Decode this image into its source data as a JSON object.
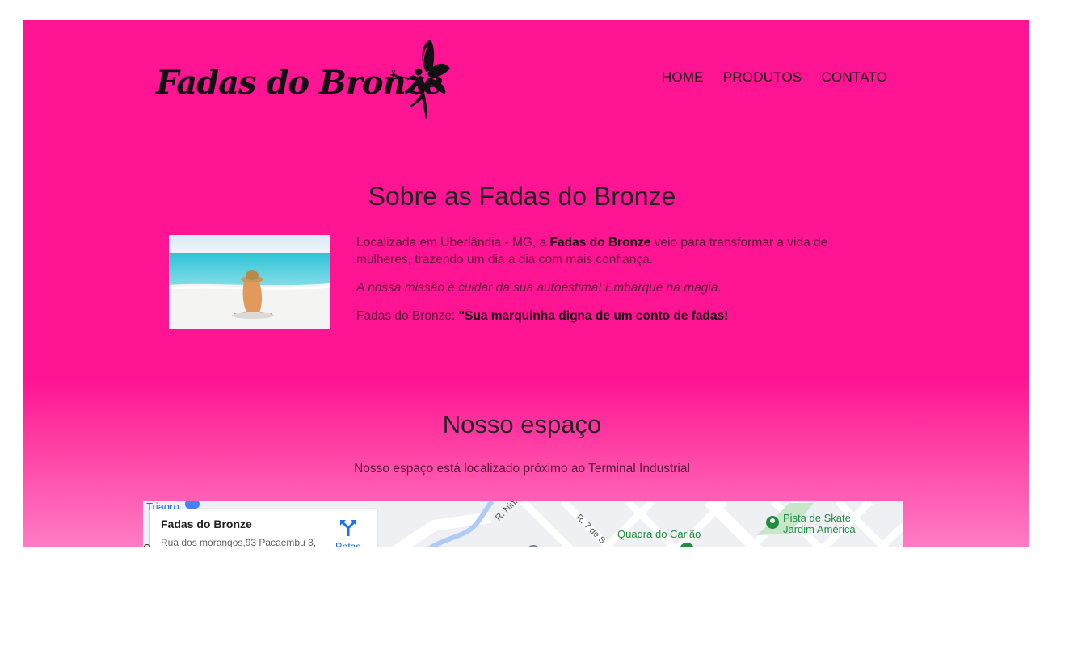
{
  "header": {
    "logo_text": "Fadas do Bronze",
    "nav": [
      "HOME",
      "PRODUTOS",
      "CONTATO"
    ]
  },
  "about": {
    "title": "Sobre as Fadas do Bronze",
    "p1_prefix": "Localizada em Uberlândia - MG, a ",
    "p1_bold": "Fadas do Bronze",
    "p1_suffix": " veio para transformar a vida de mulheres, trazendo um dia a dia com mais confiança.",
    "p2": "A nossa missão é cuidar da sua autoestima! Embarque na magia.",
    "p3_prefix": "Fadas do Bronze: ",
    "p3_bold": "\"Sua marquinha digna de um conto de fadas!"
  },
  "space": {
    "title": "Nosso espaço",
    "subtitle": "Nosso espaço está localizado próximo ao Terminal Industrial"
  },
  "map": {
    "place_name": "Fadas do Bronze",
    "address": "Rua dos morangos,93 Pacaembu 3,",
    "directions_label": "Rotas",
    "labels": {
      "triagro": "Triagro",
      "ninfa": "R. Ninfa Ar",
      "r7": "R. 7 de S",
      "quadra": "Quadra do Carlão",
      "pista_line1": "Pista de Skate",
      "pista_line2": "Jardim América",
      "partial_left": "O"
    }
  },
  "colors": {
    "background": "#ff1493",
    "gradient_end": "#ff7cc4",
    "map_green": "#1e8e3e",
    "map_blue": "#1a73e8"
  },
  "icons": [
    "fairy-icon",
    "directions-icon",
    "map-pin-icon"
  ]
}
